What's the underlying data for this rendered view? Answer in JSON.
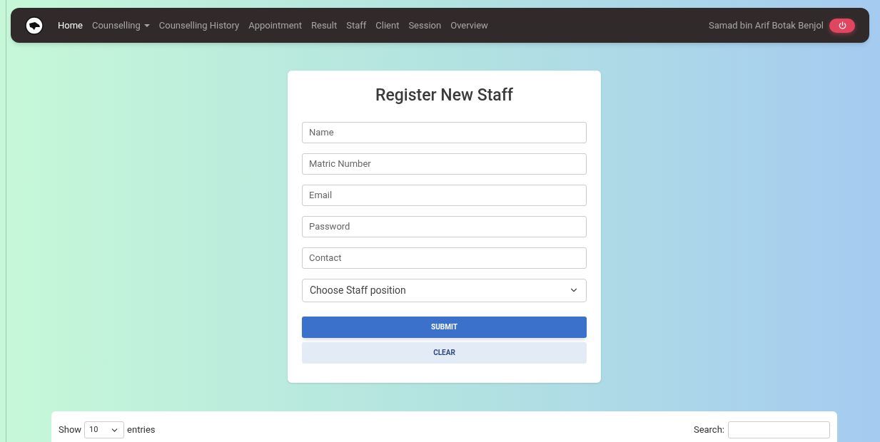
{
  "navbar": {
    "links": [
      {
        "label": "Home",
        "selected": true,
        "kind": "link"
      },
      {
        "label": "Counselling",
        "selected": false,
        "kind": "dropdown"
      },
      {
        "label": "Counselling History",
        "selected": false,
        "kind": "link"
      },
      {
        "label": "Appointment",
        "selected": false,
        "kind": "link"
      },
      {
        "label": "Result",
        "selected": false,
        "kind": "link"
      },
      {
        "label": "Staff",
        "selected": false,
        "kind": "link"
      },
      {
        "label": "Client",
        "selected": false,
        "kind": "link"
      },
      {
        "label": "Session",
        "selected": false,
        "kind": "link"
      },
      {
        "label": "Overview",
        "selected": false,
        "kind": "link"
      }
    ],
    "user_name": "Samad bin Arif Botak Benjol"
  },
  "form": {
    "title": "Register New Staff",
    "fields": [
      {
        "placeholder": "Name"
      },
      {
        "placeholder": "Matric Number"
      },
      {
        "placeholder": "Email"
      },
      {
        "placeholder": "Password"
      },
      {
        "placeholder": "Contact"
      }
    ],
    "position_select": {
      "placeholder": "Choose Staff position"
    },
    "buttons": [
      {
        "label": "SUBMIT",
        "kind": "primary"
      },
      {
        "label": "CLEAR",
        "kind": "secondary"
      }
    ]
  },
  "table_controls": {
    "show_label": "Show",
    "entries_value": "10",
    "entries_label": "entries",
    "search_label": "Search:"
  }
}
